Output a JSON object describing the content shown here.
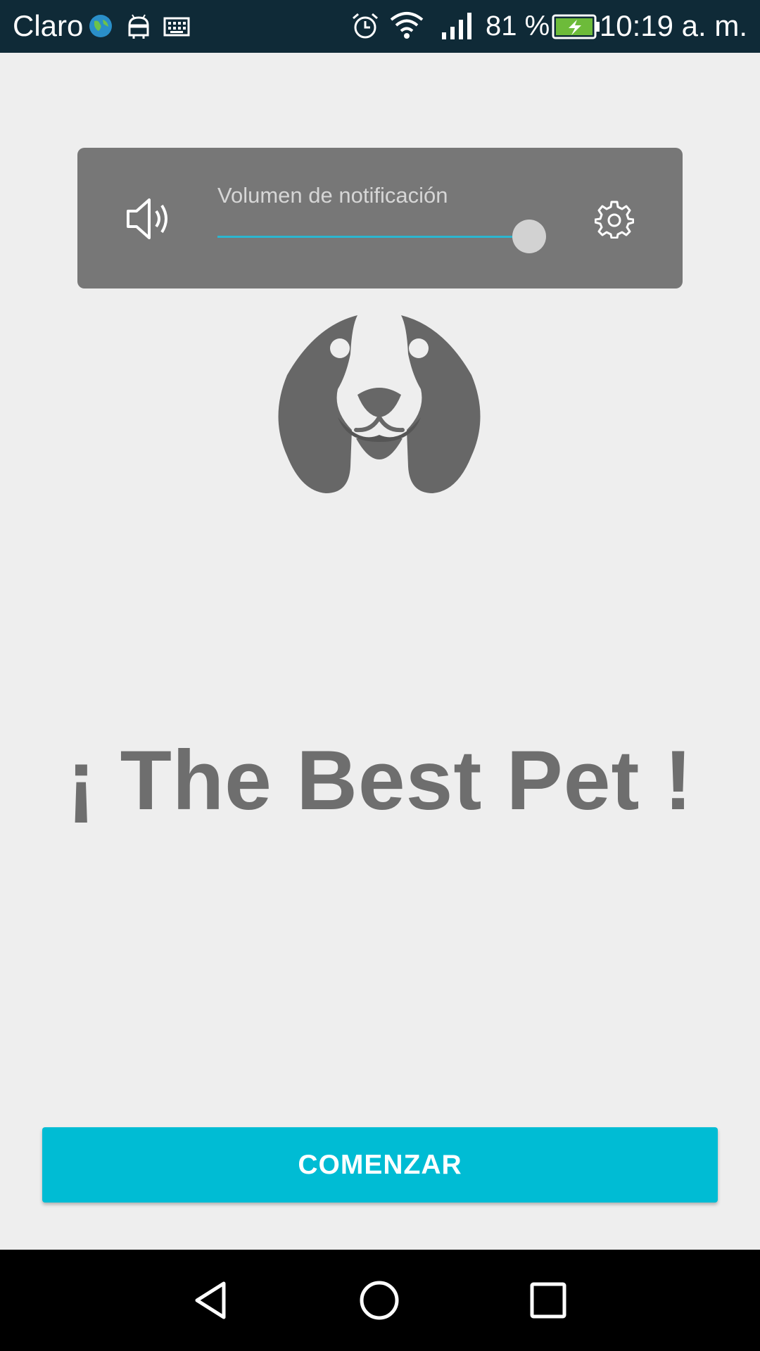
{
  "status_bar": {
    "carrier": "Claro",
    "battery_percent": "81 %",
    "time": "10:19 a. m.",
    "icons": [
      "globe-icon",
      "android-icon",
      "keyboard-icon",
      "alarm-icon",
      "wifi-icon",
      "signal-icon",
      "battery-charging-icon"
    ],
    "background": "#0f2a37"
  },
  "volume_panel": {
    "label": "Volumen de notificación",
    "level": 1.0,
    "icons": [
      "speaker-icon",
      "gear-icon"
    ],
    "accent": "#2bb6d0"
  },
  "logo": {
    "icon": "dog-face-logo"
  },
  "headline": "¡ The Best Pet !",
  "button": {
    "label": "COMENZAR",
    "color": "#00bcd4"
  },
  "nav_bar": {
    "icons": [
      "back-icon",
      "home-icon",
      "recents-icon"
    ]
  }
}
